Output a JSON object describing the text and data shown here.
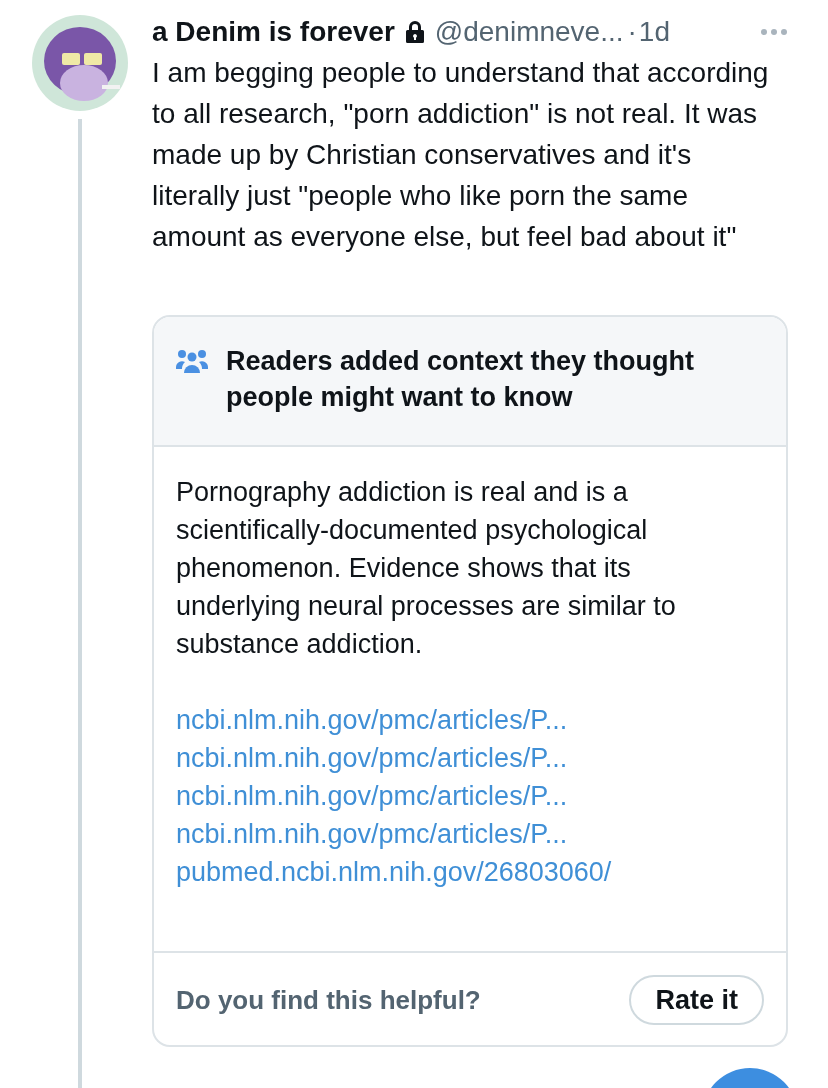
{
  "post": {
    "display_name": "a Denim is forever",
    "handle": "@denimneve...",
    "separator": "·",
    "time": "1d",
    "protected": true,
    "text": "I am begging people to understand that according to all research, \"porn addiction\" is not real. It was made up by Christian conservatives and it's literally just \"people who like porn the same amount as everyone else, but feel bad about it\""
  },
  "context_note": {
    "heading": "Readers added context they thought people might want to know",
    "body": "Pornography addiction is real and is a scientifically-documented psychological phenomenon. Evidence shows that its underlying neural processes are similar to substance addiction.",
    "links": [
      "ncbi.nlm.nih.gov/pmc/articles/P...",
      "ncbi.nlm.nih.gov/pmc/articles/P...",
      "ncbi.nlm.nih.gov/pmc/articles/P...",
      "ncbi.nlm.nih.gov/pmc/articles/P...",
      "pubmed.ncbi.nlm.nih.gov/26803060/"
    ],
    "question": "Do you find this helpful?",
    "rate_button": "Rate it"
  }
}
